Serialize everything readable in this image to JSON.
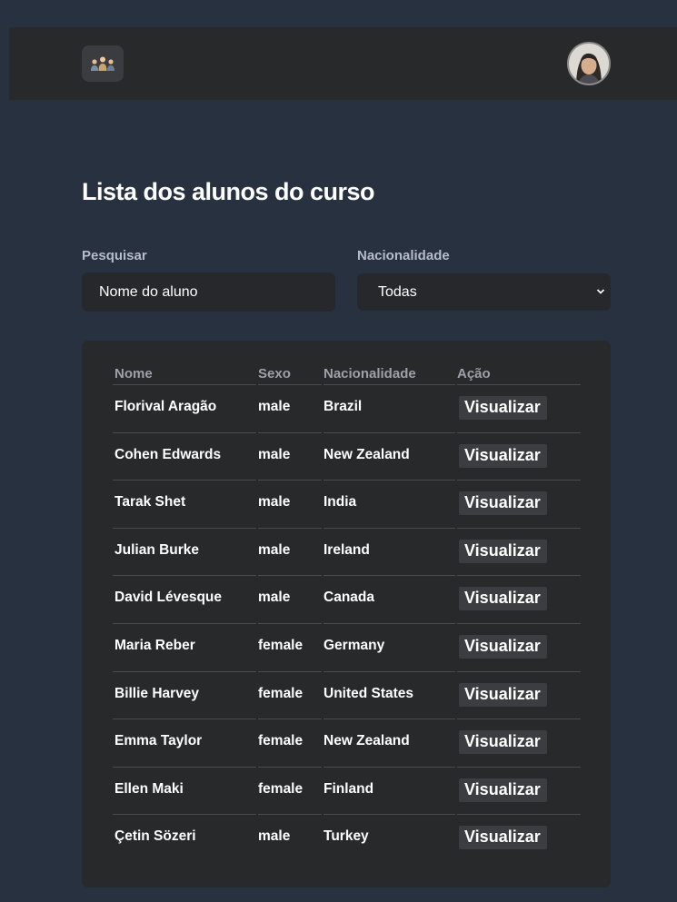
{
  "header": {
    "logo_icon": "people-group-icon",
    "avatar_icon": "user-avatar"
  },
  "page": {
    "title": "Lista dos alunos do curso"
  },
  "filters": {
    "search_label": "Pesquisar",
    "search_placeholder": "Nome do aluno",
    "nationality_label": "Nacionalidade",
    "nationality_selected": "Todas"
  },
  "table": {
    "columns": [
      "Nome",
      "Sexo",
      "Nacionalidade",
      "Ação"
    ],
    "rows": [
      {
        "nome": "Florival Aragão",
        "sexo": "male",
        "nacionalidade": "Brazil",
        "acao": "Visualizar"
      },
      {
        "nome": "Cohen Edwards",
        "sexo": "male",
        "nacionalidade": "New Zealand",
        "acao": "Visualizar"
      },
      {
        "nome": "Tarak Shet",
        "sexo": "male",
        "nacionalidade": "India",
        "acao": "Visualizar"
      },
      {
        "nome": "Julian Burke",
        "sexo": "male",
        "nacionalidade": "Ireland",
        "acao": "Visualizar"
      },
      {
        "nome": "David Lévesque",
        "sexo": "male",
        "nacionalidade": "Canada",
        "acao": "Visualizar"
      },
      {
        "nome": "Maria Reber",
        "sexo": "female",
        "nacionalidade": "Germany",
        "acao": "Visualizar"
      },
      {
        "nome": "Billie Harvey",
        "sexo": "female",
        "nacionalidade": "United States",
        "acao": "Visualizar"
      },
      {
        "nome": "Emma Taylor",
        "sexo": "female",
        "nacionalidade": "New Zealand",
        "acao": "Visualizar"
      },
      {
        "nome": "Ellen Maki",
        "sexo": "female",
        "nacionalidade": "Finland",
        "acao": "Visualizar"
      },
      {
        "nome": "Çetin Sözeri",
        "sexo": "male",
        "nacionalidade": "Turkey",
        "acao": "Visualizar"
      }
    ]
  },
  "colors": {
    "page_background": "#27313f",
    "panel_background": "#28292b",
    "button_background": "#3c3d41",
    "label_color": "#b6bccb",
    "header_color": "#9da0a8"
  }
}
